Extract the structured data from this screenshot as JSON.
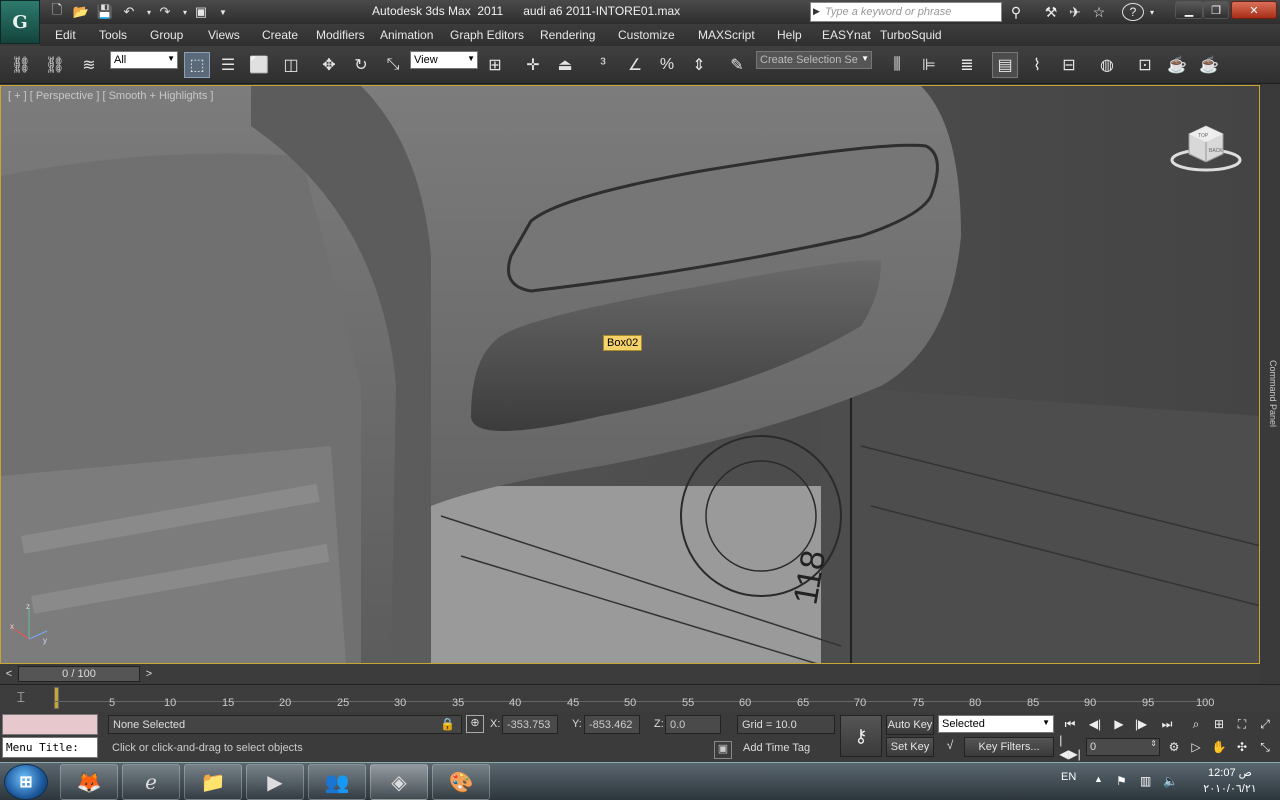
{
  "window": {
    "title": "Autodesk 3ds Max  2011      audi a6 2011-INTORE01.max",
    "search_placeholder": "Type a keyword or phrase"
  },
  "menu": [
    "Edit",
    "Tools",
    "Group",
    "Views",
    "Create",
    "Modifiers",
    "Animation",
    "Graph Editors",
    "Rendering",
    "Customize",
    "MAXScript",
    "Help",
    "EASYnat",
    "TurboSquid"
  ],
  "toolbar": {
    "filter_value": "All",
    "refcoord_value": "View",
    "selection_set_placeholder": "Create Selection Se"
  },
  "viewport": {
    "label": "[ + ] [ Perspective ] [ Smooth + Highlights ]",
    "object_tag": "Box02",
    "dimension_label": "118",
    "viewcube_top": "TOP",
    "viewcube_back": "BACK",
    "side_panel_label": "Command Panel"
  },
  "timeslider": {
    "frame": "0 / 100",
    "prev": "<",
    "next": ">"
  },
  "track_ticks": [
    "5",
    "10",
    "15",
    "20",
    "25",
    "30",
    "35",
    "40",
    "45",
    "50",
    "55",
    "60",
    "65",
    "70",
    "75",
    "80",
    "85",
    "90",
    "95",
    "100"
  ],
  "status": {
    "menu_title": "Menu Title:",
    "selection": "None Selected",
    "prompt": "Click or click-and-drag to select objects",
    "x_label": "X:",
    "x_value": "-353.753",
    "y_label": "Y:",
    "y_value": "-853.462",
    "z_label": "Z:",
    "z_value": "0.0",
    "grid": "Grid = 10.0",
    "add_time_tag": "Add Time Tag",
    "auto_key": "Auto Key",
    "set_key": "Set Key",
    "key_mode": "Selected",
    "key_filters": "Key Filters...",
    "current_frame": "0"
  },
  "taskbar": {
    "lang": "EN",
    "time": "12:07 ص",
    "date": "٢٠١٠/٠٦/٢١"
  },
  "colors": {
    "viewport_border": "#c9a534",
    "object_tag_bg": "#f5d36a",
    "listener_bg": "#e7c9cd",
    "max_logo": "#2d7a6d"
  }
}
